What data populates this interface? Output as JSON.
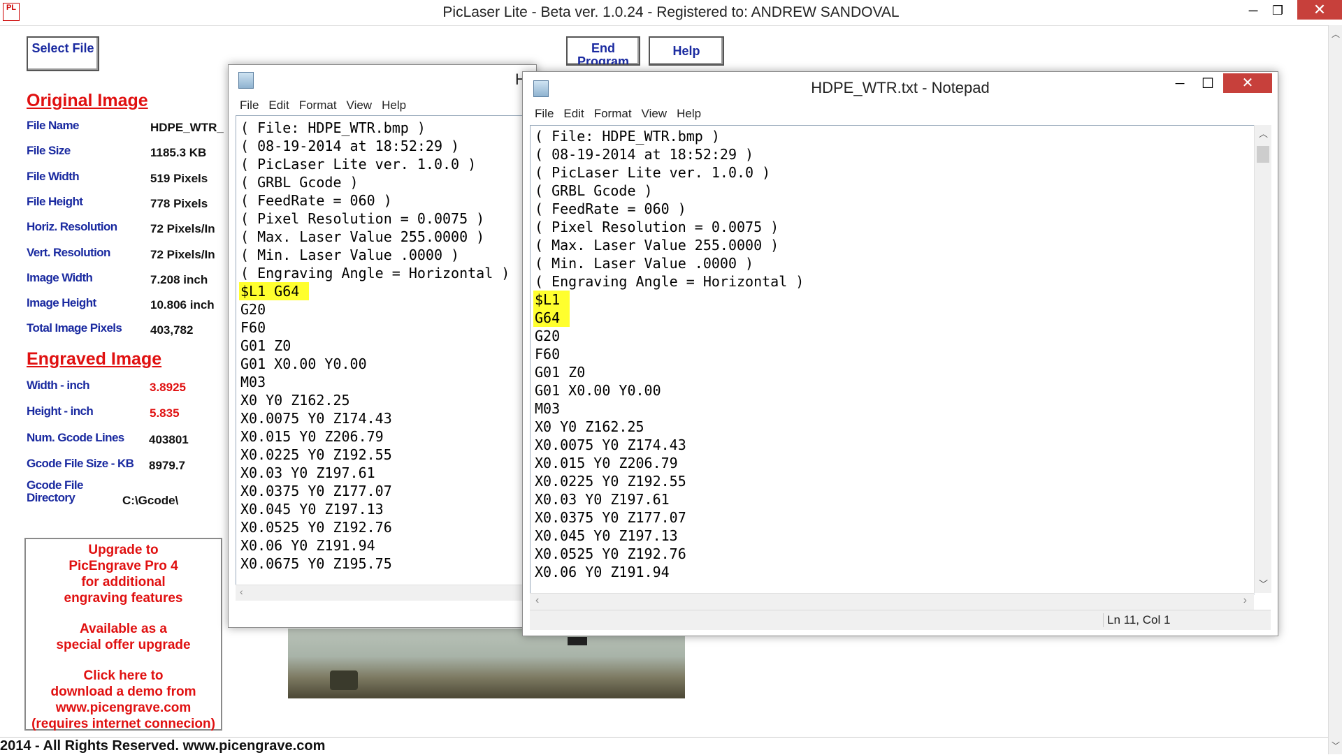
{
  "main_window": {
    "title": "PicLaser Lite - Beta ver. 1.0.24 - Registered to: ANDREW SANDOVAL",
    "icon_text": "PL",
    "minimize": "─",
    "maximize": "❐",
    "close": "✕"
  },
  "buttons": {
    "select_file": "Select File",
    "end_program": "End Program",
    "help": "Help"
  },
  "original_image": {
    "heading": "Original Image",
    "rows": [
      {
        "label": "File Name",
        "value": "HDPE_WTR_"
      },
      {
        "label": "File Size",
        "value": "1185.3  KB"
      },
      {
        "label": "File Width",
        "value": "519  Pixels"
      },
      {
        "label": "File Height",
        "value": "778  Pixels"
      },
      {
        "label": "Horiz. Resolution",
        "value": "72  Pixels/In"
      },
      {
        "label": "Vert. Resolution",
        "value": "72  Pixels/In"
      },
      {
        "label": "Image Width",
        "value": "7.208 inch"
      },
      {
        "label": "Image Height",
        "value": "10.806 inch"
      },
      {
        "label": "Total Image Pixels",
        "value": "403,782"
      }
    ]
  },
  "engraved_image": {
    "heading": "Engraved Image",
    "rows": [
      {
        "label": "Width - inch",
        "value": "3.8925"
      },
      {
        "label": "Height - inch",
        "value": "5.835"
      },
      {
        "label": "Num. Gcode Lines",
        "value": "403801"
      },
      {
        "label": "Gcode File Size - KB",
        "value": "8979.7"
      }
    ],
    "dir_label_1": "Gcode File",
    "dir_label_2": "Directory",
    "dir_value": "C:\\Gcode\\"
  },
  "upgrade": {
    "lines": [
      "Upgrade  to",
      "PicEngrave Pro 4",
      "for additional",
      "engraving  features",
      "",
      "Available as a",
      "special offer upgrade",
      "",
      "Click here to",
      "download a demo from",
      "www.picengrave.com",
      "(requires internet connecion)"
    ]
  },
  "footer": "2014 - All Rights Reserved.  www.picengrave.com",
  "notepad_back": {
    "title_fragment": "H",
    "menu": [
      "File",
      "Edit",
      "Format",
      "View",
      "Help"
    ],
    "lines": [
      "( File: HDPE_WTR.bmp )",
      "( 08-19-2014 at 18:52:29 )",
      "( PicLaser Lite ver. 1.0.0 )",
      "( GRBL Gcode )",
      "( FeedRate = 060 )",
      "( Pixel Resolution = 0.0075 )",
      "( Max. Laser Value 255.0000 )",
      "( Min. Laser Value .0000 )",
      "( Engraving Angle = Horizontal )",
      "$L1 G64",
      "G20",
      "F60",
      "G01 Z0",
      "G01 X0.00 Y0.00",
      "M03",
      "X0 Y0 Z162.25",
      "X0.0075 Y0 Z174.43",
      "X0.015 Y0 Z206.79",
      "X0.0225 Y0 Z192.55",
      "X0.03 Y0 Z197.61",
      "X0.0375 Y0 Z177.07",
      "X0.045 Y0 Z197.13",
      "X0.0525 Y0 Z192.76",
      "X0.06 Y0 Z191.94",
      "X0.0675 Y0 Z195.75"
    ]
  },
  "notepad_front": {
    "title": "HDPE_WTR.txt - Notepad",
    "menu": [
      "File",
      "Edit",
      "Format",
      "View",
      "Help"
    ],
    "minimize": "─",
    "maximize": "☐",
    "close": "✕",
    "lines": [
      "( File: HDPE_WTR.bmp )",
      "( 08-19-2014 at 18:52:29 )",
      "( PicLaser Lite ver. 1.0.0 )",
      "( GRBL Gcode )",
      "( FeedRate = 060 )",
      "( Pixel Resolution = 0.0075 )",
      "( Max. Laser Value 255.0000 )",
      "( Min. Laser Value .0000 )",
      "( Engraving Angle = Horizontal )",
      "$L1",
      "G64",
      "G20",
      "F60",
      "G01 Z0",
      "G01 X0.00 Y0.00",
      "M03",
      "X0 Y0 Z162.25",
      "X0.0075 Y0 Z174.43",
      "X0.015 Y0 Z206.79",
      "X0.0225 Y0 Z192.55",
      "X0.03 Y0 Z197.61",
      "X0.0375 Y0 Z177.07",
      "X0.045 Y0 Z197.13",
      "X0.0525 Y0 Z192.76",
      "X0.06 Y0 Z191.94"
    ],
    "status": "Ln 11, Col 1"
  }
}
